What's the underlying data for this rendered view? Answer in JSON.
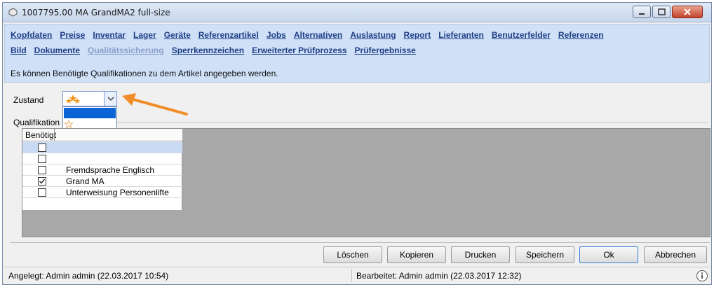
{
  "window": {
    "title": "1007795.00 MA GrandMA2 full-size"
  },
  "tabs": {
    "row1": [
      "Kopfdaten",
      "Preise",
      "Inventar",
      "Lager",
      "Geräte",
      "Referenzartikel",
      "Jobs",
      "Alternativen",
      "Auslastung",
      "Report",
      "Lieferanten",
      "Benutzerfelder",
      "Referenzen"
    ],
    "row2": [
      "Bild",
      "Dokumente",
      "Qualitätssicherung",
      "Sperrkennzeichen",
      "Erweiterter Prüfprozess",
      "Prüfergebnisse"
    ],
    "active": "Qualitätssicherung"
  },
  "hint": "Es können Benötigte Qualifikationen zu dem Artikel angegeben werden.",
  "zustand": {
    "label": "Zustand"
  },
  "qualifikation": {
    "label": "Qualifikation",
    "column_header": "Benötigt",
    "rows": [
      {
        "name": "",
        "checked": false
      },
      {
        "name": "",
        "checked": false
      },
      {
        "name": "Fremdsprache Englisch",
        "checked": false
      },
      {
        "name": "Grand MA",
        "checked": true
      },
      {
        "name": "Unterweisung Personenlifte",
        "checked": false
      }
    ]
  },
  "buttons": {
    "delete": "Löschen",
    "copy": "Kopieren",
    "print": "Drucken",
    "save": "Speichern",
    "ok": "Ok",
    "cancel": "Abbrechen"
  },
  "status": {
    "created": "Angelegt: Admin admin (22.03.2017 10:54)",
    "edited": "Bearbeitet:  Admin admin (22.03.2017 12:32)"
  },
  "colors": {
    "header_bg": "#cfe0f7",
    "link": "#1f3f86",
    "link_active": "#8a9fc9",
    "star": "#f29418",
    "arrow": "#f28c28",
    "selection": "#0a64d6"
  }
}
